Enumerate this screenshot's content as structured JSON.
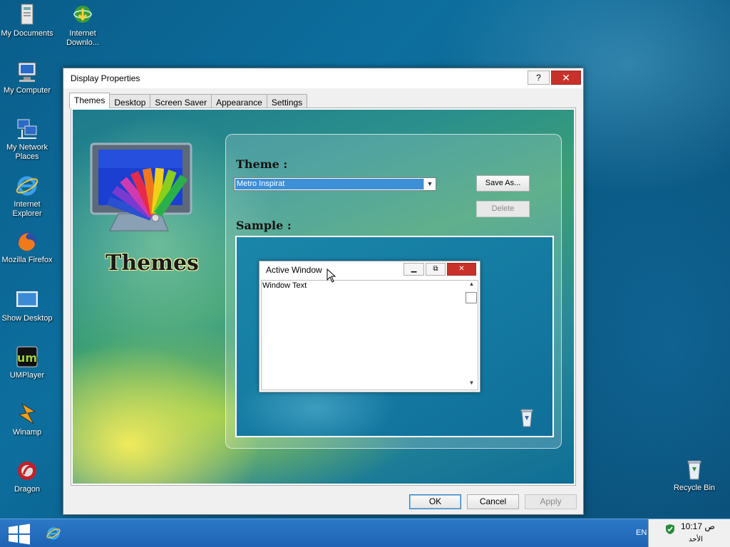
{
  "desktop": {
    "icons": [
      {
        "label": "My Documents",
        "icon": "documents-icon"
      },
      {
        "label": "Internet Downlo...",
        "icon": "download-manager-icon"
      },
      {
        "label": "My Computer",
        "icon": "computer-icon"
      },
      {
        "label": "My Network Places",
        "icon": "network-icon"
      },
      {
        "label": "Internet Explorer",
        "icon": "ie-icon"
      },
      {
        "label": "Mozilla Firefox",
        "icon": "firefox-icon"
      },
      {
        "label": "Show Desktop",
        "icon": "show-desktop-icon"
      },
      {
        "label": "UMPlayer",
        "icon": "umplayer-icon"
      },
      {
        "label": "Winamp",
        "icon": "winamp-icon"
      },
      {
        "label": "Dragon",
        "icon": "dragon-icon"
      },
      {
        "label": "Recycle Bin",
        "icon": "recycle-bin-icon"
      }
    ]
  },
  "dialog": {
    "title": "Display Properties",
    "help_label": "?",
    "close_label": "✕",
    "tabs": [
      "Themes",
      "Desktop",
      "Screen Saver",
      "Appearance",
      "Settings"
    ],
    "active_tab": "Themes",
    "logo_text": "Themes",
    "theme_label": "Theme :",
    "theme_value": "Metro Inspirat",
    "save_as_label": "Save As...",
    "delete_label": "Delete",
    "sample_label": "Sample :",
    "sample_window": {
      "title": "Active Window",
      "body_text": "Window Text"
    },
    "ok_label": "OK",
    "cancel_label": "Cancel",
    "apply_label": "Apply"
  },
  "taskbar": {
    "language": "EN",
    "time": "10:17 ص",
    "day": "الأحد"
  },
  "colors": {
    "taskbar": "#2170bf",
    "selection": "#3d8fd6",
    "close_red": "#c7312a"
  }
}
